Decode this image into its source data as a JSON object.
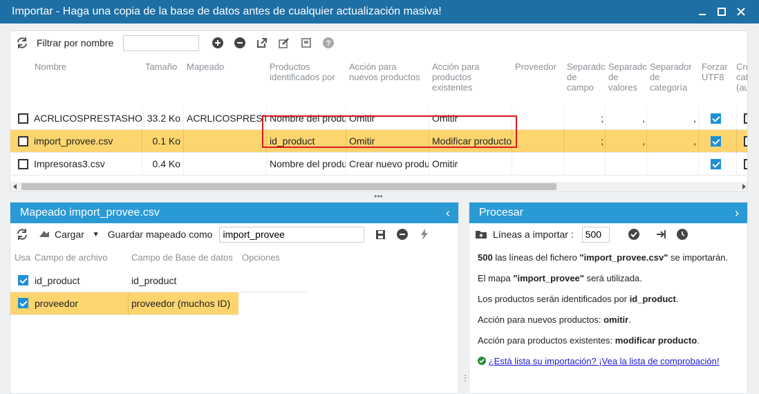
{
  "window": {
    "title": "Importar - Haga una copia de la base de datos antes de cualquier actualización masiva!"
  },
  "top_toolbar": {
    "filter_label": "Filtrar por nombre",
    "filter_value": ""
  },
  "files_grid": {
    "headers": {
      "name": "Nombre",
      "size": "Tamaño",
      "mapping": "Mapeado",
      "identified_by": "Productos identificados por",
      "new_action": "Acción para nuevos productos",
      "existing_action": "Acción para productos existentes",
      "supplier": "Proveedor",
      "field_sep": "Separador de campo",
      "value_sep": "Separador de valores",
      "cat_sep": "Separador de categoría",
      "force_utf8": "Forzar UTF8",
      "create_cat": "Crear cat. (au"
    },
    "rows": [
      {
        "name": "ACRLICOSPRESTASHOP",
        "size": "33.2 Ko",
        "mapping": "ACRLICOSPRESTASHOP",
        "identified_by": "Nombre del producto",
        "new_action": "Omitir",
        "existing_action": "Omitir",
        "supplier": "",
        "field_sep": ";",
        "value_sep": ",",
        "cat_sep": ",",
        "selected": false
      },
      {
        "name": "import_provee.csv",
        "size": "0.1 Ko",
        "mapping": "",
        "identified_by": "id_product",
        "new_action": "Omitir",
        "existing_action": "Modificar producto",
        "supplier": "",
        "field_sep": ";",
        "value_sep": ",",
        "cat_sep": ",",
        "selected": true
      },
      {
        "name": "Impresoras3.csv",
        "size": "0.4 Ko",
        "mapping": "",
        "identified_by": "Nombre del producto",
        "new_action": "Crear nuevo producto",
        "existing_action": "Omitir",
        "supplier": "",
        "field_sep": "",
        "value_sep": "",
        "cat_sep": "",
        "selected": false
      }
    ]
  },
  "mapping_panel": {
    "title": "Mapeado import_provee.csv",
    "load_label": "Cargar",
    "save_as_label": "Guardar mapeado como",
    "save_as_value": "import_provee",
    "headers": {
      "use": "Usa",
      "file_field": "Campo de archivo",
      "db_field": "Campo de Base de datos",
      "options": "Opciones"
    },
    "rows": [
      {
        "file_field": "id_product",
        "db_field": "id_product"
      },
      {
        "file_field": "proveedor",
        "db_field": "proveedor (muchos ID)"
      }
    ]
  },
  "process_panel": {
    "title": "Procesar",
    "lines_label": "Líneas a importar :",
    "lines_value": "500",
    "msg1": {
      "num": "500",
      "mid": " las líneas del fichero ",
      "file": "\"import_provee.csv\"",
      "end": " se importarán."
    },
    "msg2": {
      "pre": "El mapa ",
      "name": "\"import_provee\"",
      "end": " será utilizada."
    },
    "msg3": {
      "pre": "Los productos serán identificados por ",
      "val": "id_product",
      "end": "."
    },
    "msg4": {
      "pre": "Acción para nuevos productos: ",
      "val": "omitir",
      "end": "."
    },
    "msg5": {
      "pre": "Acción para productos existentes: ",
      "val": "modificar producto",
      "end": "."
    },
    "checklist_link": "¿Está lista su importación? ¡Vea la lista de comprobación!"
  },
  "colors": {
    "titlebar": "#1d6fa5",
    "panel_header": "#2a9ad5",
    "selected_row": "#fcd56f",
    "highlight_box": "#e0161f"
  }
}
